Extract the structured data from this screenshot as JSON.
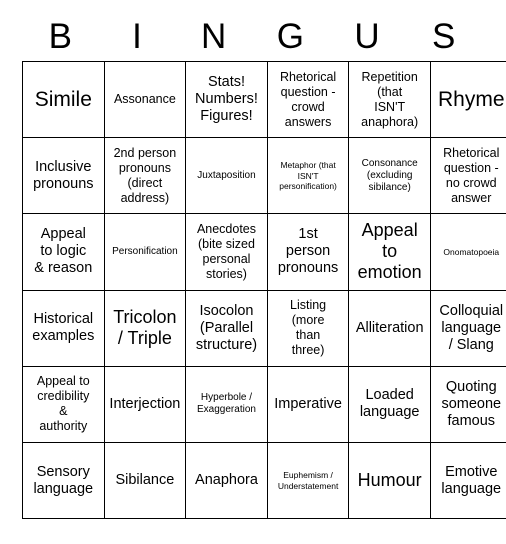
{
  "card": {
    "header_letters": [
      "B",
      "I",
      "N",
      "G",
      "U",
      "S"
    ],
    "columns": 6,
    "rows": 6,
    "border_color": "#000000",
    "background_color": "#ffffff",
    "text_color": "#000000",
    "cells": [
      [
        {
          "text": "Simile",
          "size": "xl"
        },
        {
          "text": "Assonance",
          "size": "sm"
        },
        {
          "text": "Stats!\nNumbers!\nFigures!",
          "size": "md"
        },
        {
          "text": "Rhetorical\nquestion -\ncrowd\nanswers",
          "size": "sm"
        },
        {
          "text": "Repetition\n(that\nISN'T\nanaphora)",
          "size": "sm"
        },
        {
          "text": "Rhyme",
          "size": "xl"
        }
      ],
      [
        {
          "text": "Inclusive\npronouns",
          "size": "md"
        },
        {
          "text": "2nd person\npronouns\n(direct\naddress)",
          "size": "sm"
        },
        {
          "text": "Juxtaposition",
          "size": "xs"
        },
        {
          "text": "Metaphor (that\nISN'T\npersonification)",
          "size": "xxs"
        },
        {
          "text": "Consonance\n(excluding\nsibilance)",
          "size": "xs"
        },
        {
          "text": "Rhetorical\nquestion -\nno crowd\nanswer",
          "size": "sm"
        }
      ],
      [
        {
          "text": "Appeal\nto logic\n& reason",
          "size": "md"
        },
        {
          "text": "Personification",
          "size": "xs"
        },
        {
          "text": "Anecdotes\n(bite sized\npersonal\nstories)",
          "size": "sm"
        },
        {
          "text": "1st\nperson\npronouns",
          "size": "md"
        },
        {
          "text": "Appeal\nto\nemotion",
          "size": "lg"
        },
        {
          "text": "Onomatopoeia",
          "size": "xxs"
        }
      ],
      [
        {
          "text": "Historical\nexamples",
          "size": "md"
        },
        {
          "text": "Tricolon\n/ Triple",
          "size": "lg"
        },
        {
          "text": "Isocolon\n(Parallel\nstructure)",
          "size": "md"
        },
        {
          "text": "Listing\n(more\nthan\nthree)",
          "size": "sm"
        },
        {
          "text": "Alliteration",
          "size": "md"
        },
        {
          "text": "Colloquial\nlanguage\n/ Slang",
          "size": "md"
        }
      ],
      [
        {
          "text": "Appeal to\ncredibility\n&\nauthority",
          "size": "sm"
        },
        {
          "text": "Interjection",
          "size": "md"
        },
        {
          "text": "Hyperbole /\nExaggeration",
          "size": "xs"
        },
        {
          "text": "Imperative",
          "size": "md"
        },
        {
          "text": "Loaded\nlanguage",
          "size": "md"
        },
        {
          "text": "Quoting\nsomeone\nfamous",
          "size": "md"
        }
      ],
      [
        {
          "text": "Sensory\nlanguage",
          "size": "md"
        },
        {
          "text": "Sibilance",
          "size": "md"
        },
        {
          "text": "Anaphora",
          "size": "md"
        },
        {
          "text": "Euphemism /\nUnderstatement",
          "size": "xxs"
        },
        {
          "text": "Humour",
          "size": "lg"
        },
        {
          "text": "Emotive\nlanguage",
          "size": "md"
        }
      ]
    ]
  }
}
